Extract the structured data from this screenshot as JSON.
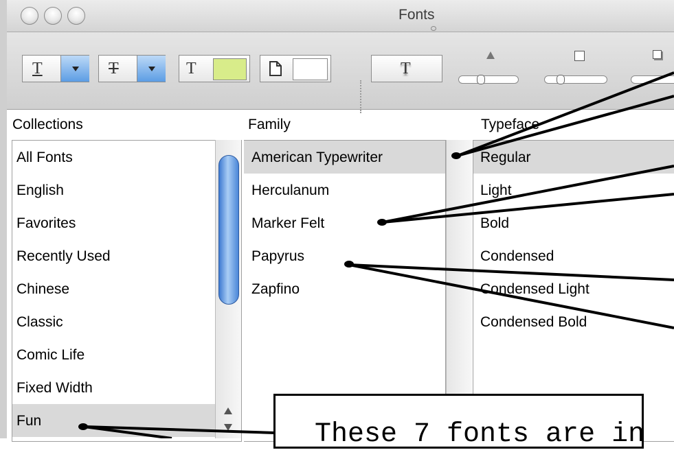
{
  "window": {
    "title": "Fonts"
  },
  "toolbar": {
    "underline_glyph": "T",
    "strike_glyph": "T",
    "text_color_glyph": "T",
    "text_color": "#d8ec8a",
    "shadow_glyph": "T"
  },
  "collections": {
    "header": "Collections",
    "items": [
      "All Fonts",
      "English",
      "Favorites",
      "Recently Used",
      "Chinese",
      "Classic",
      "Comic Life",
      "Fixed Width",
      "Fun"
    ],
    "selected": "Fun"
  },
  "family": {
    "header": "Family",
    "items": [
      "American Typewriter",
      "Herculanum",
      "Marker Felt",
      "Papyrus",
      "Zapfino"
    ],
    "selected": "American Typewriter"
  },
  "typeface": {
    "header": "Typeface",
    "items": [
      "Regular",
      "Light",
      "Bold",
      "Condensed",
      "Condensed Light",
      "Condensed Bold"
    ],
    "selected": "Regular"
  },
  "annotation": {
    "text": "These 7 fonts are in"
  }
}
